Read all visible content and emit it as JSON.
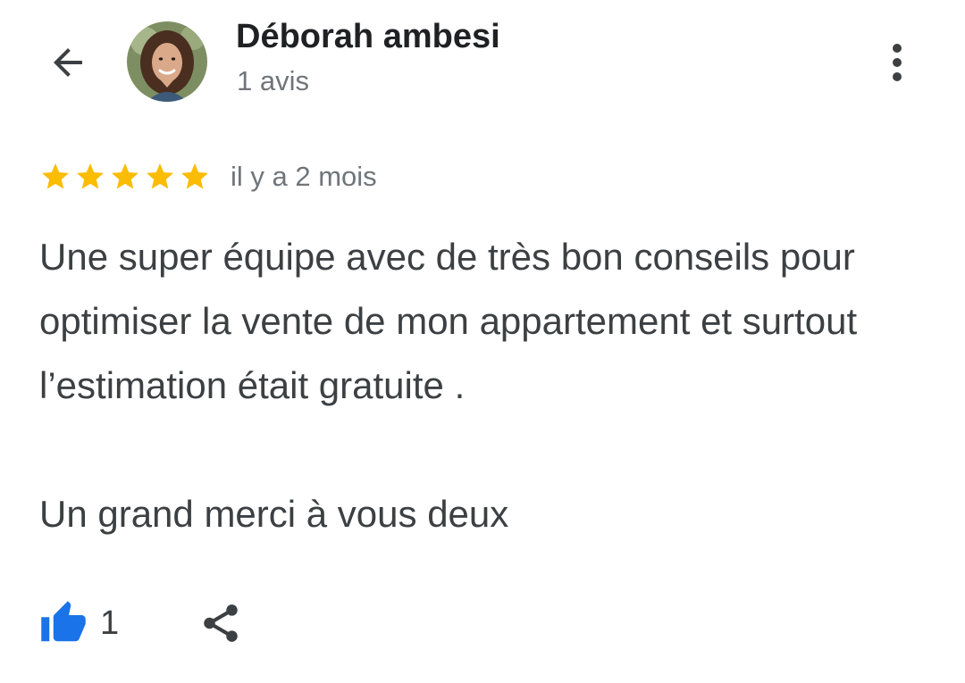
{
  "header": {
    "back_icon": "arrow-back-icon",
    "avatar_icon": "avatar",
    "author_name": "Déborah ambesi",
    "review_count": "1 avis",
    "more_icon": "more-vert-icon"
  },
  "review": {
    "rating": 5,
    "rating_max": 5,
    "star_color": "#fbbc04",
    "date": "il y a 2 mois",
    "paragraph_1": "Une super équipe avec de très bon conseils pour optimiser la vente de mon appartement et surtout l’estimation était gratuite .",
    "paragraph_2": "Un grand merci à vous deux"
  },
  "actions": {
    "like_icon": "thumb-up-icon",
    "like_color": "#1a73e8",
    "like_count": "1",
    "share_icon": "share-icon"
  }
}
